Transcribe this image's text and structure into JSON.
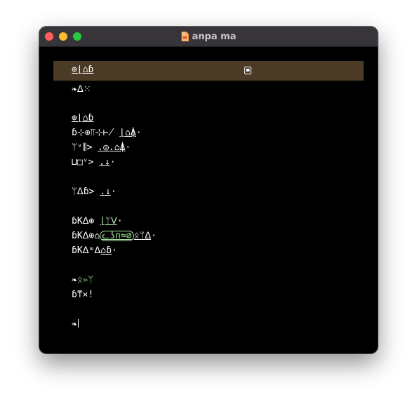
{
  "window": {
    "title": "anpa ma",
    "accent_colors": {
      "header_bar": "#4a3a26",
      "highlight_text": "#a9e6a1",
      "close": "#fe5f57",
      "minimize": "#febc2e",
      "maximize": "#28c840"
    }
  },
  "header": {
    "title": "⊕⌊⌂ɓ",
    "icon": "document-icon"
  },
  "lines": {
    "l1": "❧ᐃ⁙",
    "l2": "⊕⌊⌂ɓ",
    "l3_a": "ɓ⊹⊕⫪⊹⊬ ",
    "l3_b": "⌊⌂⍋",
    "l3_c": "·",
    "l4_a": "ᛘᵛ⫼> ",
    "l4_b": ".◎.⌂⍋",
    "l4_c": "·",
    "l5_a": "⊔□ᵛ> ",
    "l5_b": ".↓",
    "l5_c": "·",
    "l6_a": "ᛘᐃɓ> ",
    "l6_b": ".↓",
    "l6_c": "·",
    "l7_a": "ɓKᐃ⊕ ",
    "l7_b": "⌊ᛘᐯ",
    "l7_c": "·",
    "l8_a": "ɓKᐃ⊕⌂",
    "l8_b": "ᓚʖ∩≈⌀",
    "l8_c": "ᛟᛘᐃ",
    "l8_d": "·",
    "l9_a": "ɓKᐃᵚᐃ",
    "l9_b": "⌂ɓ",
    "l9_c": "·",
    "l10_a": "❧",
    "l10_b": "ᛟ≫ᛘ",
    "l11": "ɓ⍑⨯!",
    "prompt": "❧"
  }
}
